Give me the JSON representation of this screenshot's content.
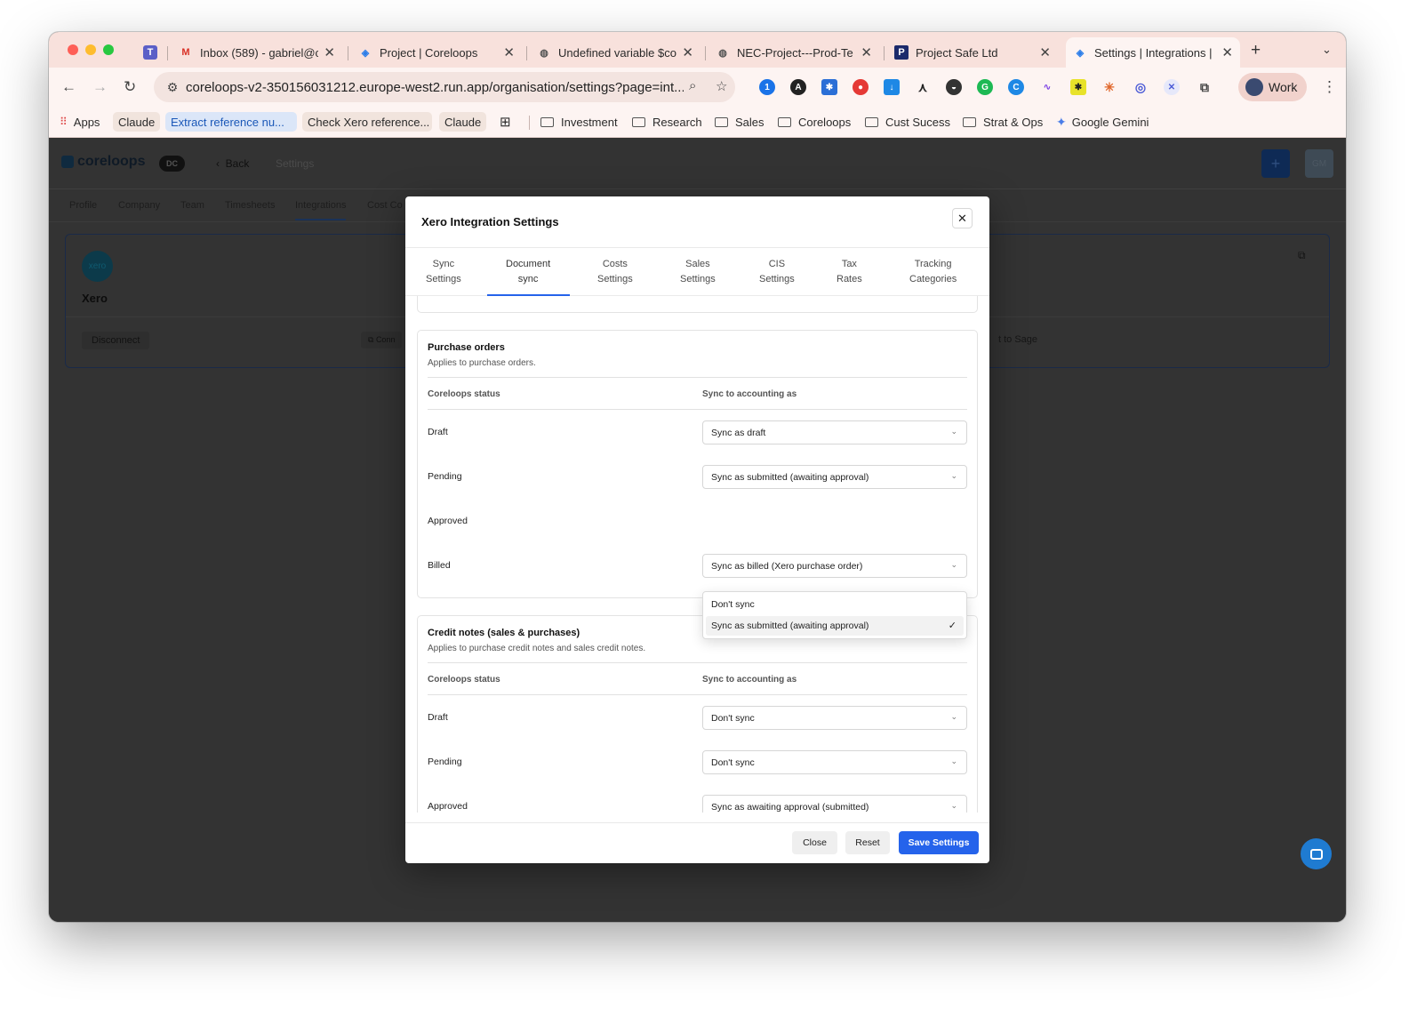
{
  "browser": {
    "tabs": [
      {
        "title": "Inbox (589) - gabriel@c",
        "icon": "gmail-icon"
      },
      {
        "title": "Project | Coreloops",
        "icon": "coreloops-icon"
      },
      {
        "title": "Undefined variable $co",
        "icon": "globe-icon"
      },
      {
        "title": "NEC-Project---Prod-Te",
        "icon": "globe-icon"
      },
      {
        "title": "Project Safe Ltd",
        "icon": "p-icon"
      },
      {
        "title": "Settings | Integrations |",
        "icon": "coreloops-icon"
      }
    ],
    "url": "coreloops-v2-350156031212.europe-west2.run.app/organisation/settings?page=int...",
    "profile": "Work",
    "bookmarks": {
      "apps": "Apps",
      "claude1": "Claude",
      "extract": "Extract reference nu...",
      "check": "Check Xero reference...",
      "claude2": "Claude",
      "investment": "Investment",
      "research": "Research",
      "sales": "Sales",
      "coreloops": "Coreloops",
      "cust": "Cust Sucess",
      "strat": "Strat & Ops",
      "gemini": "Google Gemini"
    }
  },
  "app": {
    "logo": "coreloops",
    "badge": "DC",
    "back": "Back",
    "crumb": "Settings",
    "avatar": "GM",
    "tabs": {
      "profile": "Profile",
      "company": "Company",
      "team": "Team",
      "timesheets": "Timesheets",
      "integrations": "Integrations",
      "cost": "Cost Co"
    },
    "card": {
      "logo_text": "xero",
      "name": "Xero",
      "disconnect": "Disconnect",
      "connect": "Conn",
      "sage": "t to Sage"
    }
  },
  "modal": {
    "title": "Xero Integration Settings",
    "tabs": [
      [
        "Sync",
        "Settings"
      ],
      [
        "Document",
        "sync"
      ],
      [
        "Costs",
        "Settings"
      ],
      [
        "Sales",
        "Settings"
      ],
      [
        "CIS",
        "Settings"
      ],
      [
        "Tax",
        "Rates"
      ],
      [
        "Tracking",
        "Categories"
      ]
    ],
    "purchase_orders": {
      "title": "Purchase orders",
      "desc": "Applies to purchase orders.",
      "col_status": "Coreloops status",
      "col_sync": "Sync to accounting as",
      "rows": [
        {
          "label": "Draft",
          "value": "Sync as draft"
        },
        {
          "label": "Pending",
          "value": "Sync as submitted (awaiting approval)"
        },
        {
          "label": "Approved",
          "value": ""
        },
        {
          "label": "Billed",
          "value": "Sync as billed (Xero purchase order)"
        }
      ]
    },
    "dropdown": {
      "options": [
        "Don't sync",
        "Sync as submitted (awaiting approval)"
      ],
      "selected": "Sync as submitted (awaiting approval)"
    },
    "credit_notes": {
      "title": "Credit notes (sales & purchases)",
      "desc": "Applies to purchase credit notes and sales credit notes.",
      "col_status": "Coreloops status",
      "col_sync": "Sync to accounting as",
      "rows": [
        {
          "label": "Draft",
          "value": "Don't sync"
        },
        {
          "label": "Pending",
          "value": "Don't sync"
        },
        {
          "label": "Approved",
          "value": "Sync as awaiting approval (submitted)"
        }
      ]
    },
    "buttons": {
      "close": "Close",
      "reset": "Reset",
      "save": "Save Settings"
    }
  },
  "colors": {
    "accent": "#2563eb",
    "tab_bar": "#f8e1dc",
    "overlay_bg": "#333333"
  }
}
